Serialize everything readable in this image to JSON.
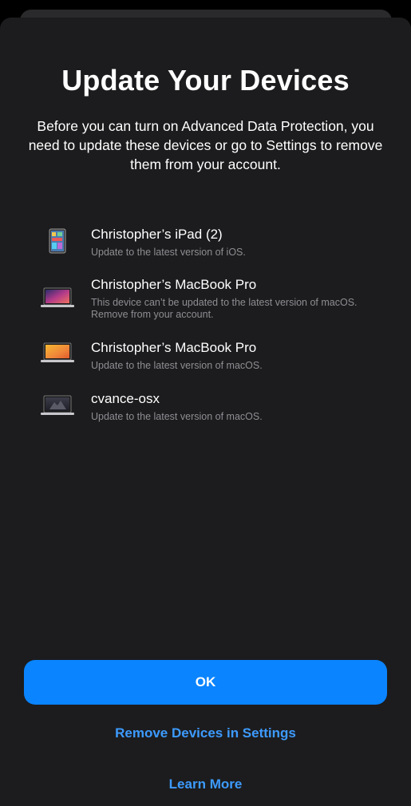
{
  "dialog": {
    "title": "Update Your Devices",
    "subtitle": "Before you can turn on Advanced Data Protection, you need to update these devices or go to Settings to remove them from your account."
  },
  "devices": [
    {
      "name": "Christopher’s iPad (2)",
      "description": "Update to the latest version of iOS.",
      "icon": "ipad-icon"
    },
    {
      "name": "Christopher’s MacBook Pro",
      "description": "This device can’t be updated to the latest version of macOS. Remove from your account.",
      "icon": "macbook-pro-icon"
    },
    {
      "name": "Christopher’s MacBook Pro",
      "description": "Update to the latest version of macOS.",
      "icon": "macbook-pro-icon"
    },
    {
      "name": "cvance-osx",
      "description": "Update to the latest version of macOS.",
      "icon": "macbook-icon"
    }
  ],
  "actions": {
    "ok_label": "OK",
    "remove_label": "Remove Devices in Settings",
    "learn_more_label": "Learn More"
  },
  "colors": {
    "accent": "#0a84ff",
    "link": "#3d9bff",
    "background": "#1c1c1e",
    "secondary_text": "#8e8e93"
  }
}
